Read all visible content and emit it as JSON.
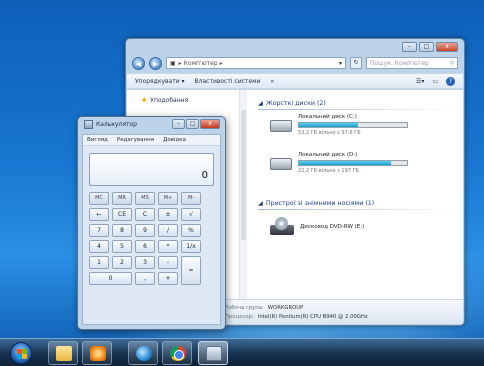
{
  "explorer": {
    "address": "▸ Комп'ютер ▸",
    "search_placeholder": "Пошук: Комп'ютер",
    "toolbar": {
      "organize": "Упорядкувати ▾",
      "system_properties": "Властивості системи",
      "more": "»"
    },
    "nav": {
      "favorites": "Уподобання"
    },
    "groups": {
      "hard_drives": "Жорсткі диски (2)",
      "removable": "Пристрої зі знімними носіями (1)"
    },
    "drives": [
      {
        "name": "Локальний диск (C:)",
        "free": "53,2 ГБ вільно з 97,6 ГБ",
        "fill": 0.55
      },
      {
        "name": "Локальний диск (D:)",
        "free": "22,2 ГБ вільно з 197 ГБ",
        "fill": 0.85
      }
    ],
    "dvd": {
      "name": "Дисковод DVD-RW (E:)"
    },
    "details": {
      "workgroup_label": "Робоча група:",
      "workgroup_value": "WORKGROUP",
      "processor_label": "Процесор:",
      "processor_value": "Intel(R) Pentium(R) CPU B940 @ 2.00GHz"
    }
  },
  "calculator": {
    "title": "Калькулятор",
    "menu": [
      "Вигляд",
      "Редагування",
      "Довідка"
    ],
    "display": "0",
    "keys": [
      "MC",
      "MR",
      "MS",
      "M+",
      "M-",
      "←",
      "CE",
      "C",
      "±",
      "√",
      "7",
      "8",
      "9",
      "/",
      "%",
      "4",
      "5",
      "6",
      "*",
      "1/x",
      "1",
      "2",
      "3",
      "-",
      "=",
      "0",
      ",",
      "+"
    ]
  },
  "window_controls": {
    "minimize": "–",
    "maximize": "□",
    "close": "x"
  },
  "colors": {
    "accent": "#1a9ecf",
    "taskbar": "#17324f",
    "desktop": "#1877d2"
  }
}
